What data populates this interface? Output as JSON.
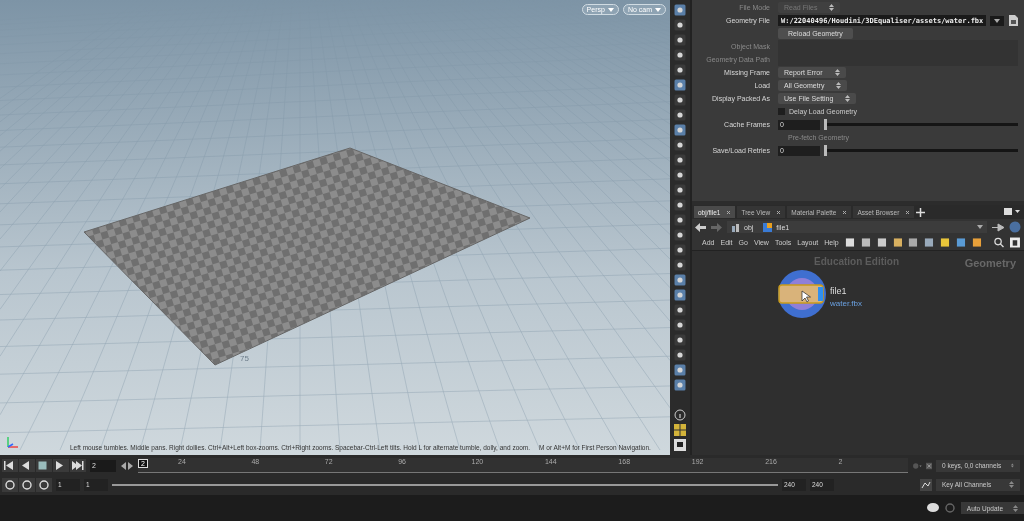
{
  "viewport": {
    "camera_menus": [
      {
        "label": "Persp"
      },
      {
        "label": "No cam"
      }
    ],
    "help_text": "Left mouse tumbles. Middle pans. Right dollies. Ctrl+Alt+Left box-zooms. Ctrl+Right zooms. Spacebar-Ctrl-Left tilts. Hold L for alternate tumble, dolly, and zoom.     M or Alt+M for First Person Navigation.",
    "grid_label": "75"
  },
  "parameters": [
    {
      "kind": "menu",
      "label": "File Mode",
      "value": "Read Files",
      "disabled": true
    },
    {
      "kind": "file",
      "label": "Geometry File",
      "value": "W:/22040496/Houdini/3DEqualiser/assets/water.fbx",
      "disabled": false
    },
    {
      "kind": "button",
      "text": "Reload Geometry",
      "disabled": false
    },
    {
      "kind": "text",
      "label": "Object Mask",
      "disabled": true
    },
    {
      "kind": "text",
      "label": "Geometry Data Path",
      "disabled": true
    },
    {
      "kind": "menu",
      "label": "Missing Frame",
      "value": "Report Error",
      "disabled": false
    },
    {
      "kind": "menu",
      "label": "Load",
      "value": "All Geometry",
      "disabled": false
    },
    {
      "kind": "menu",
      "label": "Display Packed As",
      "value": "Use File Setting",
      "disabled": false
    },
    {
      "kind": "checkbox",
      "text": "Delay Load Geometry",
      "checked": false,
      "disabled": false
    },
    {
      "kind": "slider",
      "label": "Cache Frames",
      "value": "0",
      "level": 0,
      "disabled": false
    },
    {
      "kind": "toggle",
      "text": "Pre-fetch Geometry",
      "disabled": true
    },
    {
      "kind": "slider",
      "label": "Save/Load Retries",
      "value": "0",
      "level": 0,
      "disabled": false
    }
  ],
  "network": {
    "tabs": [
      {
        "label": "obj/file1",
        "selected": true
      },
      {
        "label": "Tree View",
        "selected": false
      },
      {
        "label": "Material Palette",
        "selected": false
      },
      {
        "label": "Asset Browser",
        "selected": false
      }
    ],
    "path": [
      "obj",
      "file1"
    ],
    "menu": [
      "Add",
      "Edit",
      "Go",
      "View",
      "Tools",
      "Layout",
      "Help"
    ],
    "edition": "Education Edition",
    "context": "Geometry",
    "node": {
      "name": "file1",
      "file": "water.fbx"
    }
  },
  "timeline": {
    "frame": "2",
    "current_marker": "2",
    "ticks": [
      "24",
      "48",
      "72",
      "96",
      "120",
      "144",
      "168",
      "192",
      "216",
      "2"
    ],
    "start": [
      "1",
      "1"
    ],
    "end": [
      "240",
      "240"
    ],
    "range": {
      "level": 1
    },
    "keys": "0 keys, 0,0 channels",
    "key_button": "Key All Channels"
  },
  "status_bar": {
    "update_mode": "Auto Update"
  }
}
